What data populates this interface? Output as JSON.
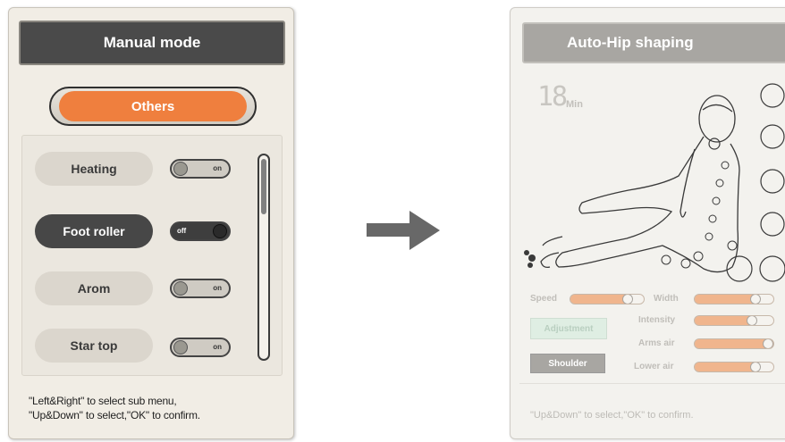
{
  "left_screen": {
    "title": "Manual mode",
    "category_tab": "Others",
    "items": [
      {
        "label": "Heating",
        "toggle": "on",
        "active": false
      },
      {
        "label": "Foot roller",
        "toggle": "off",
        "active": true
      },
      {
        "label": "Arom",
        "toggle": "on",
        "active": false
      },
      {
        "label": "Star top",
        "toggle": "on",
        "active": false
      }
    ],
    "hint_line1": "\"Left&Right\" to select sub menu,",
    "hint_line2": "\"Up&Down\" to select,\"OK\" to confirm."
  },
  "right_screen": {
    "title": "Auto-Hip shaping",
    "timer_value": "18",
    "timer_unit": "Min",
    "sliders": {
      "speed": {
        "label": "Speed",
        "level": 0.75
      },
      "width": {
        "label": "Width",
        "level": 0.75
      },
      "intensity": {
        "label": "Intensity",
        "level": 0.7
      },
      "arms_air": {
        "label": "Arms air",
        "level": 1.0
      },
      "lower_air": {
        "label": "Lower air",
        "level": 0.75
      }
    },
    "adjustment_button": "Adjustment",
    "shoulder_button": "Shoulder",
    "hint": "\"Up&Down\" to select,\"OK\" to confirm."
  },
  "colors": {
    "accent_orange": "#ef7f3e",
    "dark_bar": "#4a4a4a",
    "slider_fill": "#f0b58d"
  }
}
